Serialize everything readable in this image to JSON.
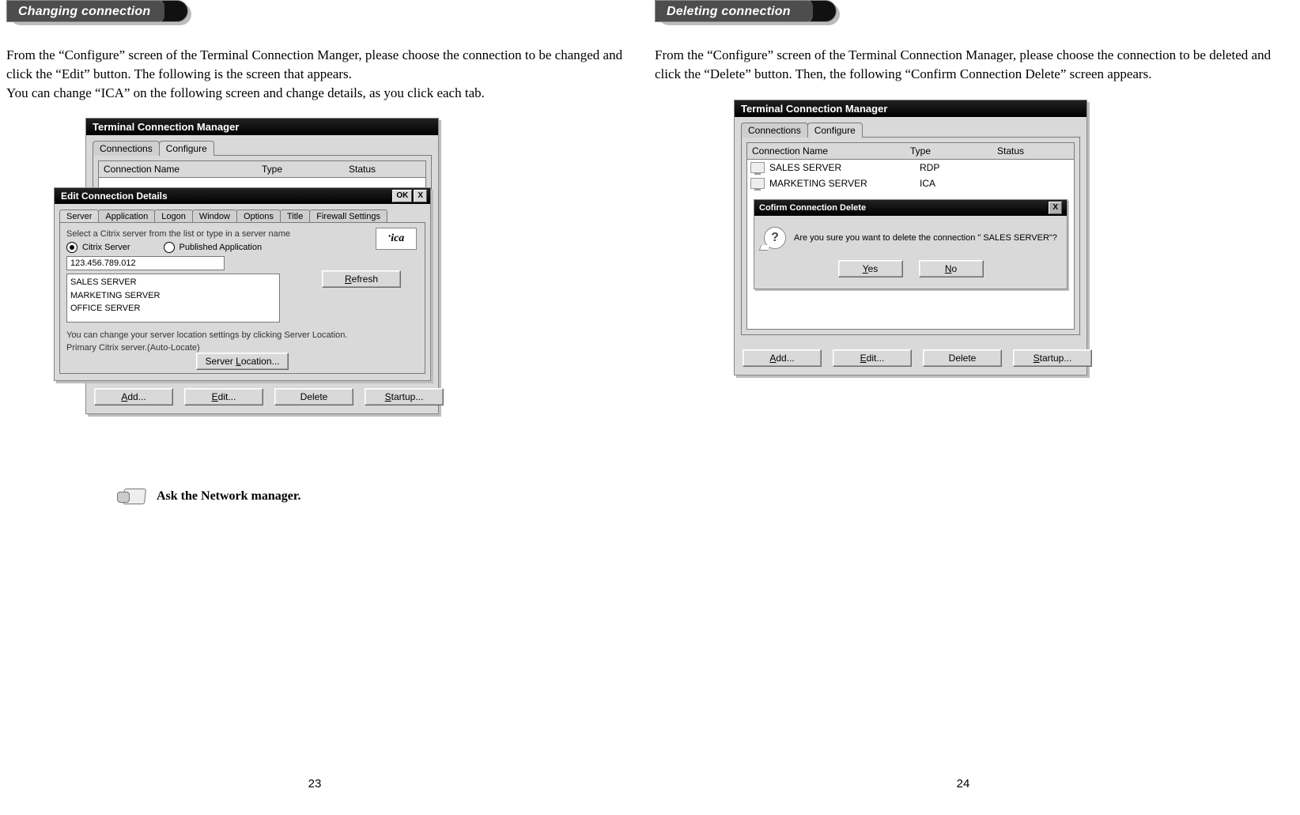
{
  "left": {
    "pill": "Changing connection",
    "intro": "From the “Configure” screen of the Terminal Connection Manger, please choose the connection to be changed and click the “Edit” button. The following is the screen that appears.\nYou can change “ICA” on the following screen and change details, as you click each tab.",
    "tcm": {
      "title": "Terminal Connection Manager",
      "tabs": {
        "connections": "Connections",
        "configure": "Configure"
      },
      "headers": {
        "name": "Connection Name",
        "type": "Type",
        "status": "Status"
      },
      "buttons": {
        "add": "Add...",
        "edit": "Edit...",
        "delete": "Delete",
        "startup": "Startup..."
      }
    },
    "edit": {
      "title": "Edit Connection Details",
      "ok": "OK",
      "x": "X",
      "tabs": [
        "Server",
        "Application",
        "Logon",
        "Window",
        "Options",
        "Title",
        "Firewall Settings"
      ],
      "hint": "Select a Citrix server from the list or type in a server name",
      "radio1": "Citrix Server",
      "radio2": "Published Application",
      "ip": "123.456.789.012",
      "servers": [
        "SALES  SERVER",
        "MARKETING  SERVER",
        "OFFICE  SERVER"
      ],
      "ica_logo": "ica",
      "refresh": "Refresh",
      "note1": "You can change your server location settings by clicking Server Location.",
      "note2": "Primary Citrix server.(Auto-Locate)",
      "server_loc": "Server Location..."
    },
    "ask": "Ask the Network manager.",
    "page": "23"
  },
  "right": {
    "pill": "Deleting connection",
    "intro": "From the “Configure” screen of the Terminal Connection Manager, please choose the connection to be deleted and click the “Delete” button. Then, the following “Confirm Connection Delete” screen appears.",
    "tcm": {
      "title": "Terminal Connection Manager",
      "tabs": {
        "connections": "Connections",
        "configure": "Configure"
      },
      "headers": {
        "name": "Connection Name",
        "type": "Type",
        "status": "Status"
      },
      "rows": [
        {
          "name": "SALES SERVER",
          "type": "RDP"
        },
        {
          "name": "MARKETING SERVER",
          "type": "ICA"
        }
      ],
      "buttons": {
        "add": "Add...",
        "edit": "Edit...",
        "delete": "Delete",
        "startup": "Startup..."
      }
    },
    "confirm": {
      "title": "Cofirm Connection Delete",
      "x": "X",
      "msg": "Are you sure you want to delete the connection \" SALES SERVER\"?",
      "yes": "Yes",
      "no": "No"
    },
    "page": "24"
  }
}
